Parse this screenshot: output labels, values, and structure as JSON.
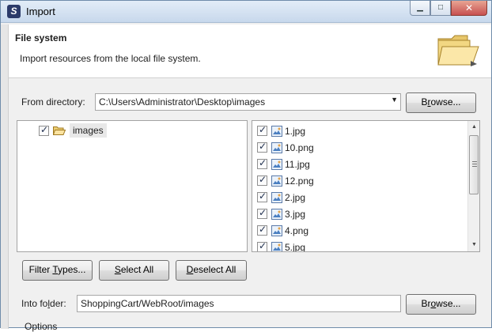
{
  "window": {
    "title": "Import",
    "app_icon": "S",
    "minimize_label": "▁",
    "maximize_label": "□",
    "close_label": "✕"
  },
  "banner": {
    "title": "File system",
    "description": "Import resources from the local file system.",
    "icon": "folder-open-icon"
  },
  "directory": {
    "label": "From directory:",
    "value": "C:\\Users\\Administrator\\Desktop\\images",
    "browse_pre": "B",
    "browse_ul": "r",
    "browse_post": "owse..."
  },
  "tree": {
    "items": [
      {
        "label": "images",
        "checked": true
      }
    ]
  },
  "files": {
    "items": [
      {
        "name": "1.jpg",
        "checked": true
      },
      {
        "name": "10.png",
        "checked": true
      },
      {
        "name": "11.jpg",
        "checked": true
      },
      {
        "name": "12.png",
        "checked": true
      },
      {
        "name": "2.jpg",
        "checked": true
      },
      {
        "name": "3.jpg",
        "checked": true
      },
      {
        "name": "4.png",
        "checked": true
      },
      {
        "name": "5.jpg",
        "checked": true
      }
    ]
  },
  "buttons": {
    "filter_pre": "Filter ",
    "filter_ul": "T",
    "filter_post": "ypes...",
    "select_ul": "S",
    "select_post": "elect All",
    "deselect_ul": "D",
    "deselect_post": "eselect All"
  },
  "into_folder": {
    "label_pre": "Into fo",
    "label_ul": "l",
    "label_post": "der:",
    "value": "ShoppingCart/WebRoot/images",
    "browse_pre": "Br",
    "browse_ul": "o",
    "browse_post": "wse..."
  },
  "options": {
    "label": "Options"
  }
}
